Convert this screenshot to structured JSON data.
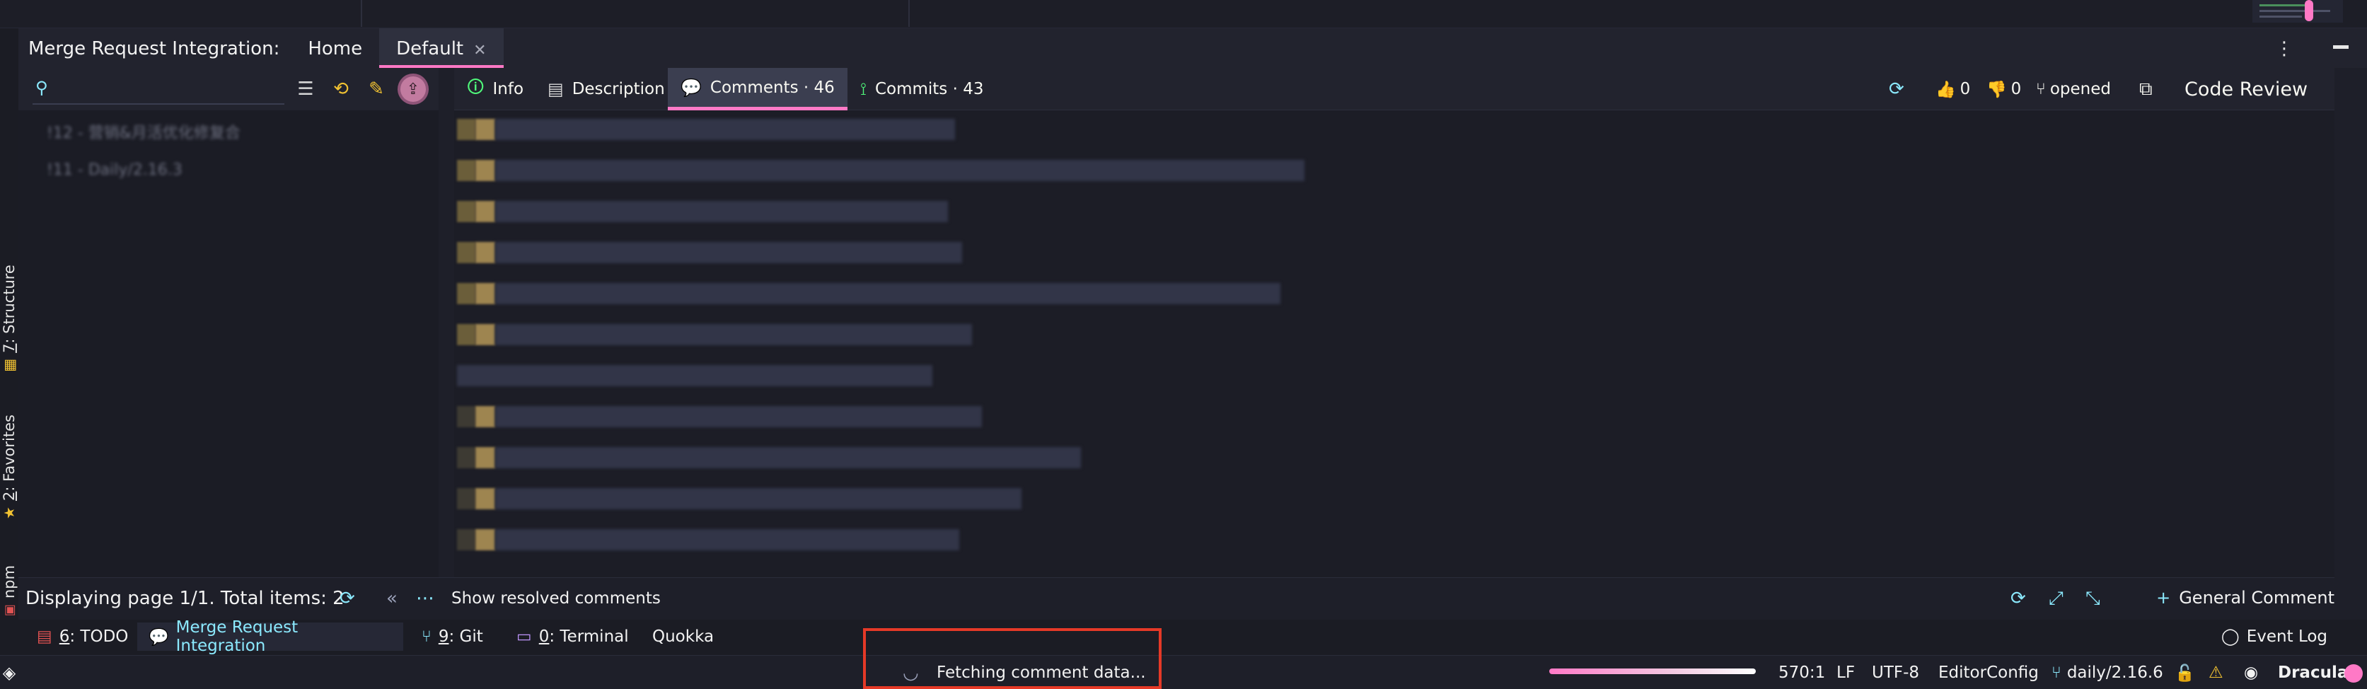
{
  "tool_window": {
    "title": "Merge Request Integration:",
    "tabs": [
      {
        "label": "Home",
        "active": false
      },
      {
        "label": "Default",
        "active": true,
        "closable": true
      }
    ],
    "menu_icon": "more-vertical-icon",
    "hide_icon": "minimize-icon"
  },
  "left_stripe": {
    "tabs": [
      {
        "number": "7",
        "label": ": Structure"
      },
      {
        "number": "2",
        "label": ": Favorites"
      },
      {
        "number": "",
        "label": "npm"
      }
    ]
  },
  "search": {
    "placeholder": "",
    "value": ""
  },
  "left_toolbar_icons": [
    "search-icon",
    "list-icon",
    "history-icon",
    "edit-icon",
    "publish-icon"
  ],
  "merge_requests": [
    {
      "label": "!12 - 营销&月活优化修复合"
    },
    {
      "label": "!11 - Daily/2.16.3"
    }
  ],
  "detail_tabs": [
    {
      "label": "Info",
      "icon": "info-icon"
    },
    {
      "label": "Description",
      "icon": "document-icon"
    },
    {
      "label": "Comments · 46",
      "icon": "comments-icon",
      "active": true
    },
    {
      "label": "Commits · 43",
      "icon": "commit-icon"
    }
  ],
  "header_right": {
    "thumbs_up_count": "0",
    "thumbs_down_count": "0",
    "state": "opened",
    "code_review_label": "Code Review"
  },
  "footer": {
    "page_info": "Displaying page 1/1. Total items: 2",
    "show_resolved_label": "Show resolved comments",
    "general_comment_label": "General Comment"
  },
  "bottom_tabs": [
    {
      "number": "6",
      "label": ": TODO",
      "icon": "todo-icon"
    },
    {
      "number": "",
      "label": "Merge Request Integration",
      "icon": "comments-icon",
      "active": true
    },
    {
      "number": "9",
      "label": ": Git",
      "icon": "git-icon"
    },
    {
      "number": "0",
      "label": ": Terminal",
      "icon": "terminal-icon"
    },
    {
      "number": "",
      "label": "Quokka",
      "icon": ""
    }
  ],
  "event_log_label": "Event Log",
  "status_bar": {
    "fetch_message": "Fetching comment data...",
    "progress_fraction": 0.96,
    "cursor_position": "570:1",
    "line_separator": "LF",
    "encoding": "UTF-8",
    "editorconfig": "EditorConfig",
    "branch": "daily/2.16.6",
    "theme": "Dracula"
  },
  "colors": {
    "accent": "#ff79c6",
    "cyan": "#8be9fd",
    "yellow": "#f1c232",
    "background": "#1e1f29",
    "highlight_box": "#e53927"
  }
}
